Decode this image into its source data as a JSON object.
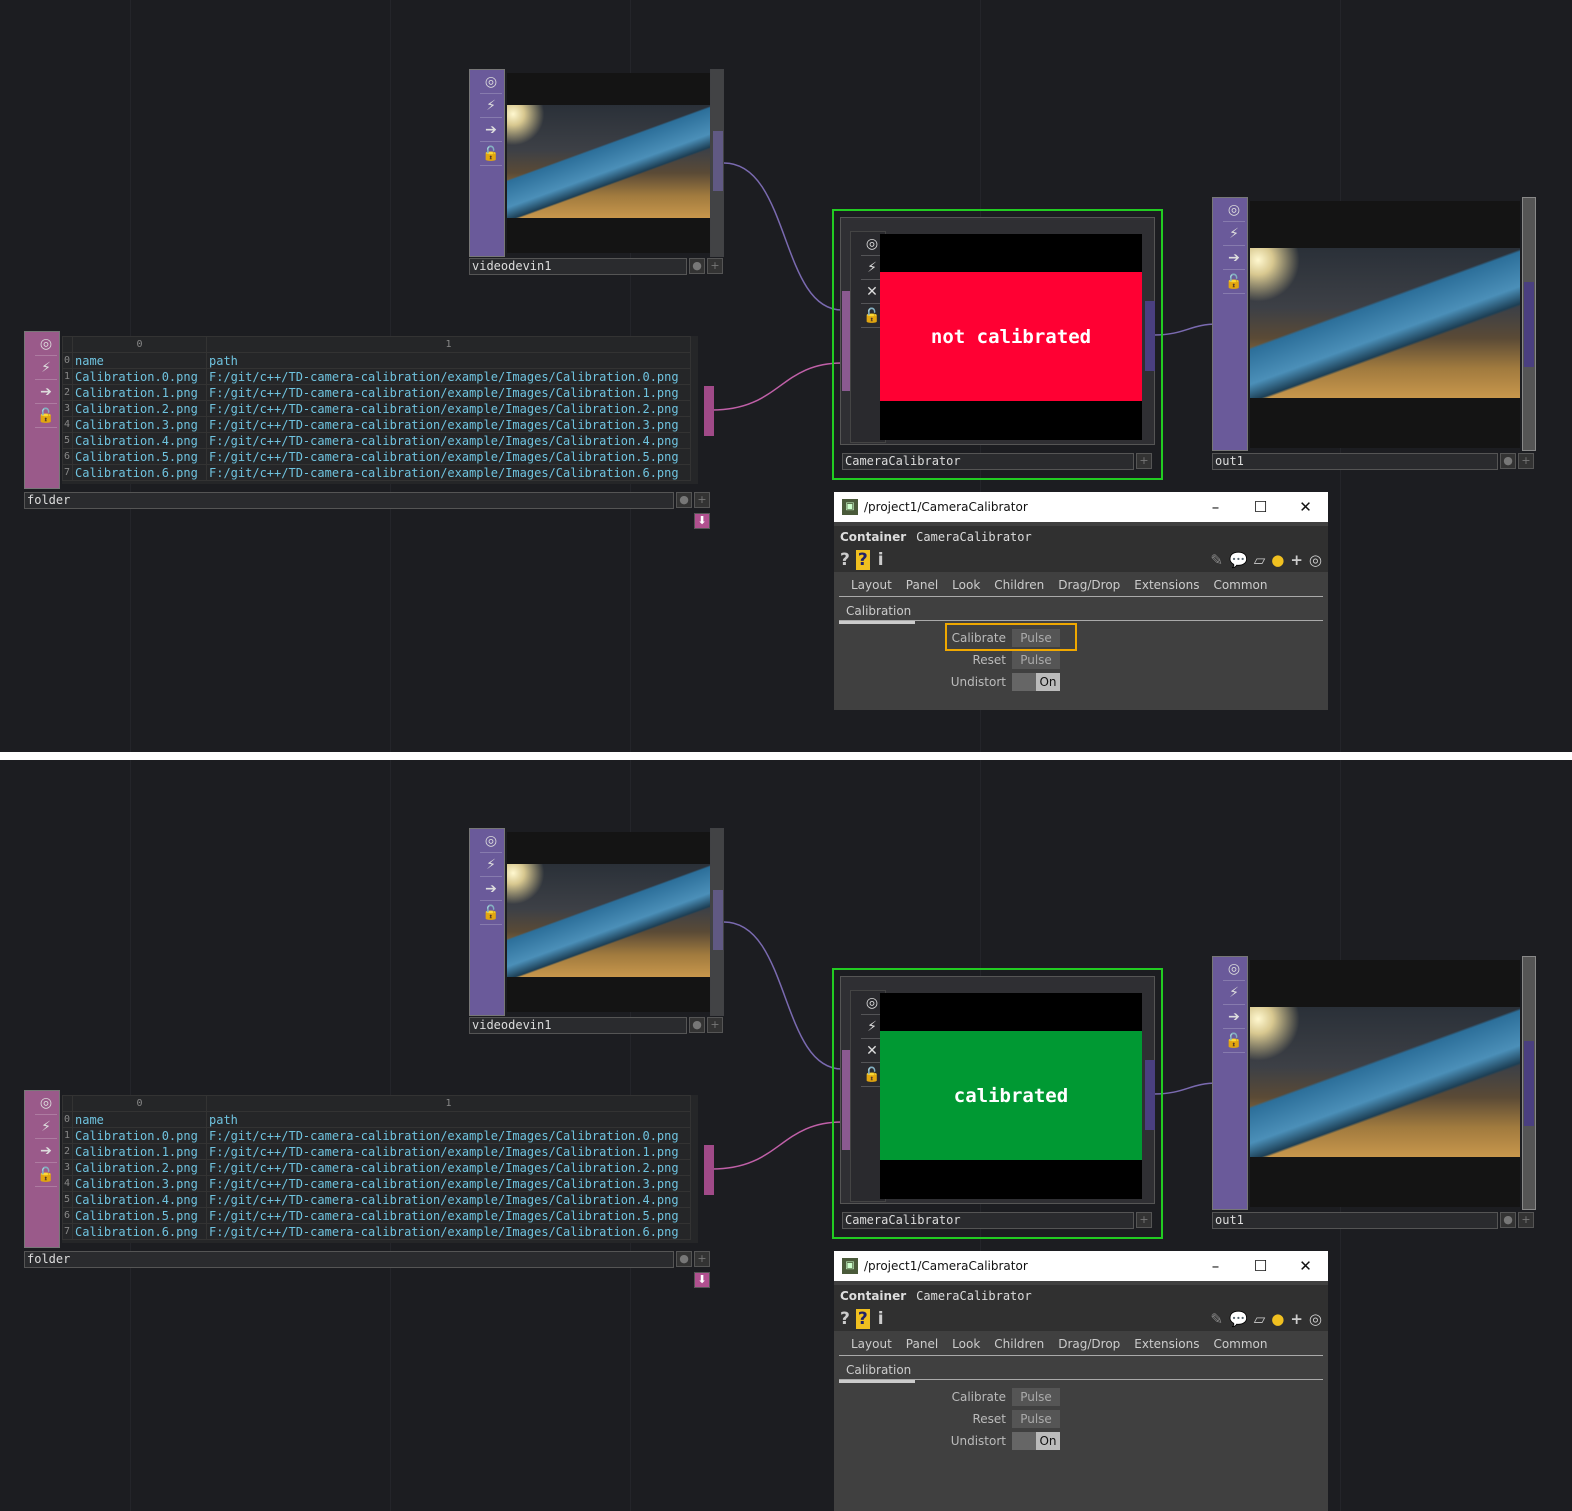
{
  "scenes": [
    {
      "status_text": "not calibrated",
      "status_color": "#ff0033",
      "calibrate_highlighted": true
    },
    {
      "status_text": "calibrated",
      "status_color": "#009933",
      "calibrate_highlighted": false
    }
  ],
  "nodes": {
    "video": "videodevin1",
    "folder": "folder",
    "calibrator": "CameraCalibrator",
    "out": "out1"
  },
  "table": {
    "col_headers": [
      "0",
      "1"
    ],
    "rows": [
      {
        "i": "0",
        "name": "name",
        "path": "path"
      },
      {
        "i": "1",
        "name": "Calibration.0.png",
        "path": "F:/git/c++/TD-camera-calibration/example/Images/Calibration.0.png"
      },
      {
        "i": "2",
        "name": "Calibration.1.png",
        "path": "F:/git/c++/TD-camera-calibration/example/Images/Calibration.1.png"
      },
      {
        "i": "3",
        "name": "Calibration.2.png",
        "path": "F:/git/c++/TD-camera-calibration/example/Images/Calibration.2.png"
      },
      {
        "i": "4",
        "name": "Calibration.3.png",
        "path": "F:/git/c++/TD-camera-calibration/example/Images/Calibration.3.png"
      },
      {
        "i": "5",
        "name": "Calibration.4.png",
        "path": "F:/git/c++/TD-camera-calibration/example/Images/Calibration.4.png"
      },
      {
        "i": "6",
        "name": "Calibration.5.png",
        "path": "F:/git/c++/TD-camera-calibration/example/Images/Calibration.5.png"
      },
      {
        "i": "7",
        "name": "Calibration.6.png",
        "path": "F:/git/c++/TD-camera-calibration/example/Images/Calibration.6.png"
      }
    ]
  },
  "param_window": {
    "title": "/project1/CameraCalibrator",
    "type_label": "Container",
    "name": "CameraCalibrator",
    "tabs": [
      "Layout",
      "Panel",
      "Look",
      "Children",
      "Drag/Drop",
      "Extensions",
      "Common"
    ],
    "active_tab": "Calibration",
    "params": [
      {
        "label": "Calibrate",
        "value": "Pulse"
      },
      {
        "label": "Reset",
        "value": "Pulse"
      },
      {
        "label": "Undistort",
        "value": "On"
      }
    ]
  },
  "colors": {
    "selected_border": "#22cc22",
    "top_sidebar": "#6a5a9a",
    "dat_sidebar": "#9a5a8a",
    "highlight": "#f0a800"
  }
}
